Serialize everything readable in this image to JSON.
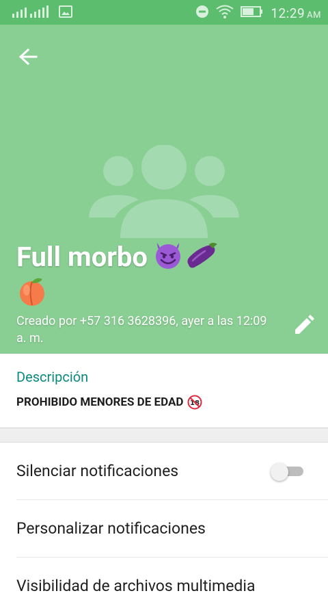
{
  "status_bar": {
    "time": "12:29",
    "ampm": "AM",
    "icons": [
      "signal-icon",
      "image-icon",
      "dnd-icon",
      "wifi-icon",
      "battery-icon"
    ]
  },
  "header": {
    "back_icon": "arrow-back-icon",
    "title": "Full morbo",
    "title_emoji": [
      "smiling-devil",
      "eggplant",
      "peach"
    ],
    "created_text": "Creado por +57 316 3628396, ayer a las 12:09 a. m.",
    "edit_icon": "pencil-icon",
    "avatar_icon": "group-icon"
  },
  "description": {
    "label": "Descripción",
    "text": "PROHIBIDO MENORES DE EDAD",
    "badge_icon": "no-under-18-icon"
  },
  "settings": [
    {
      "label": "Silenciar notificaciones",
      "toggle": false
    },
    {
      "label": "Personalizar notificaciones"
    },
    {
      "label": "Visibilidad de archivos multimedia"
    }
  ],
  "colors": {
    "status_bar": "#5cbd6f",
    "header": "#89ce93",
    "accent": "#0b8a80",
    "divider": "#e6e6e6"
  }
}
